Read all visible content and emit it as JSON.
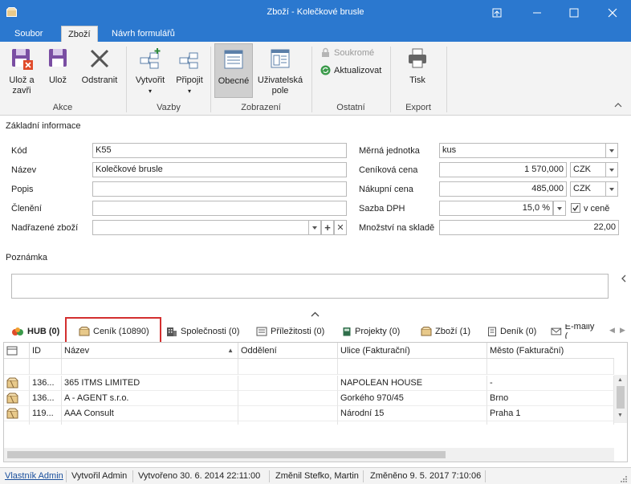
{
  "window": {
    "title": "Zboží - Kolečkové brusle"
  },
  "tabs": {
    "file": "Soubor",
    "goods": "Zboží",
    "form_design": "Návrh formulářů"
  },
  "ribbon": {
    "save_close": "Ulož a zavři",
    "save": "Ulož",
    "delete": "Odstranit",
    "create": "Vytvořit",
    "attach": "Připojit",
    "general": "Obecné",
    "user_fields": "Uživatelská pole",
    "private": "Soukromé",
    "refresh": "Aktualizovat",
    "print": "Tisk",
    "groups": {
      "actions": "Akce",
      "links": "Vazby",
      "display": "Zobrazení",
      "other": "Ostatní",
      "export": "Export"
    }
  },
  "form": {
    "section_basic": "Základní informace",
    "code_label": "Kód",
    "code_value": "K55",
    "name_label": "Název",
    "name_value": "Kolečkové brusle",
    "desc_label": "Popis",
    "desc_value": "",
    "category_label": "Členění",
    "category_value": "",
    "parent_label": "Nadřazené zboží",
    "parent_value": "",
    "unit_label": "Měrná jednotka",
    "unit_value": "kus",
    "price_label": "Ceníková cena",
    "price_value": "1 570,000",
    "price_currency": "CZK",
    "purchase_label": "Nákupní cena",
    "purchase_value": "485,000",
    "purchase_currency": "CZK",
    "vat_label": "Sazba DPH",
    "vat_value": "15,0 %",
    "vat_incl_label": "v ceně",
    "stock_label": "Množství na skladě",
    "stock_value": "22,00",
    "note_label": "Poznámka",
    "note_value": ""
  },
  "subtabs": {
    "hub": "HUB (0)",
    "pricelist": "Ceník (10890)",
    "companies": "Společnosti (0)",
    "opportunities": "Příležitosti (0)",
    "projects": "Projekty (0)",
    "goods": "Zboží (1)",
    "diary": "Deník (0)",
    "email": "E-maily ("
  },
  "grid": {
    "columns": [
      "ID",
      "Název",
      "Oddělení",
      "Ulice (Fakturační)",
      "Město (Fakturační)"
    ],
    "rows": [
      {
        "id": "136...",
        "name": "365 ITMS LIMITED",
        "dept": "",
        "street": "NAPOLEAN HOUSE",
        "city": "-"
      },
      {
        "id": "136...",
        "name": "A - AGENT s.r.o.",
        "dept": "",
        "street": "Gorkého 970/45",
        "city": "Brno"
      },
      {
        "id": "119...",
        "name": "AAA Consult",
        "dept": "",
        "street": "Národní 15",
        "city": "Praha 1"
      }
    ]
  },
  "status": {
    "owner": "Vlastník Admin",
    "creator": "Vytvořil Admin",
    "created": "Vytvořeno 30. 6. 2014 22:11:00",
    "modifier": "Změnil Stefko, Martin",
    "modified": "Změněno 9. 5. 2017 7:10:06"
  },
  "colors": {
    "titlebar": "#2b78cf",
    "highlight_border": "#d32f2f"
  }
}
